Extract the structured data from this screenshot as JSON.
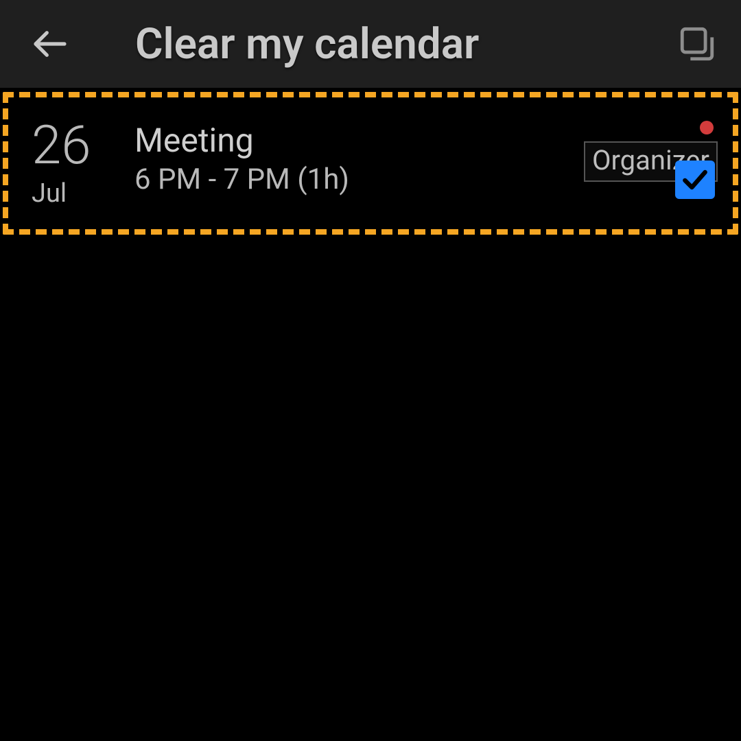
{
  "header": {
    "title": "Clear my calendar"
  },
  "events": [
    {
      "day": "26",
      "month": "Jul",
      "title": "Meeting",
      "time": "6 PM - 7 PM (1h)",
      "role": "Organizer",
      "status_color": "#d23c3c",
      "checked": true
    }
  ]
}
